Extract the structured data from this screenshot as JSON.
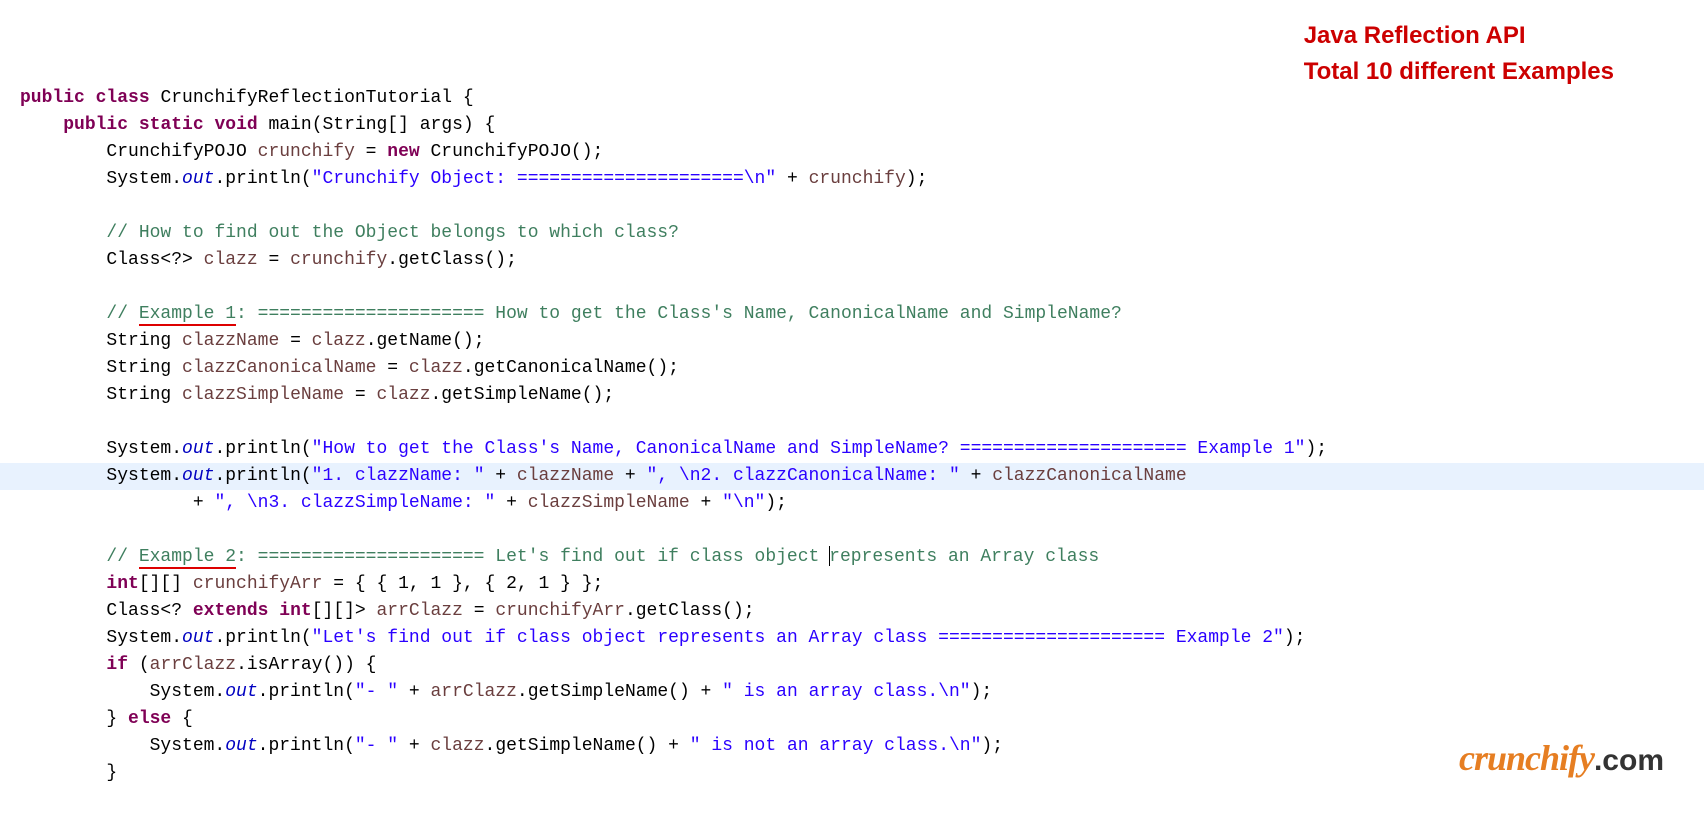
{
  "annotation": {
    "line1": "Java Reflection API",
    "line2": "Total 10 different Examples"
  },
  "logo": {
    "brand": "crunchify",
    "suffix": ".com"
  },
  "code": {
    "l1_public": "public",
    "l1_class": "class",
    "l1_name": " CrunchifyReflectionTutorial {",
    "l2_public": "public",
    "l2_static": "static",
    "l2_void": "void",
    "l2_sig": " main(String[] args) {",
    "l3_a": "CrunchifyPOJO ",
    "l3_var": "crunchify",
    "l3_b": " = ",
    "l3_new": "new",
    "l3_c": " CrunchifyPOJO();",
    "l4_a": "System.",
    "l4_out": "out",
    "l4_b": ".println(",
    "l4_str": "\"Crunchify Object: =====================\\n\"",
    "l4_c": " + ",
    "l4_var": "crunchify",
    "l4_d": ");",
    "l6_cmt": "// How to find out the Object belongs to which class?",
    "l7_a": "Class<?> ",
    "l7_var": "clazz",
    "l7_b": " = ",
    "l7_var2": "crunchify",
    "l7_c": ".getClass();",
    "l9_cmt_a": "// ",
    "l9_ex": "Example 1",
    "l9_cmt_b": ": ===================== How to get the Class's Name, CanonicalName and SimpleName?",
    "l10_a": "String ",
    "l10_var": "clazzName",
    "l10_b": " = ",
    "l10_var2": "clazz",
    "l10_c": ".getName();",
    "l11_a": "String ",
    "l11_var": "clazzCanonicalName",
    "l11_b": " = ",
    "l11_var2": "clazz",
    "l11_c": ".getCanonicalName();",
    "l12_a": "String ",
    "l12_var": "clazzSimpleName",
    "l12_b": " = ",
    "l12_var2": "clazz",
    "l12_c": ".getSimpleName();",
    "l14_a": "System.",
    "l14_out": "out",
    "l14_b": ".println(",
    "l14_str": "\"How to get the Class's Name, CanonicalName and SimpleName? ===================== Example 1\"",
    "l14_c": ");",
    "l15_a": "System.",
    "l15_out": "out",
    "l15_b": ".println(",
    "l15_str1": "\"1. clazzName: \"",
    "l15_c": " + ",
    "l15_var1": "clazzName",
    "l15_d": " + ",
    "l15_str2": "\", \\n2. clazzCanonicalName: \"",
    "l15_e": " + ",
    "l15_var2": "clazzCanonicalName",
    "l16_a": "+ ",
    "l16_str1": "\", \\n3. clazzSimpleName: \"",
    "l16_b": " + ",
    "l16_var": "clazzSimpleName",
    "l16_c": " + ",
    "l16_str2": "\"\\n\"",
    "l16_d": ");",
    "l18_cmt_a": "// ",
    "l18_ex": "Example 2",
    "l18_cmt_b": ": ===================== Let's find out if class object ",
    "l18_cmt_c": "represents an Array class",
    "l19_int": "int",
    "l19_a": "[][] ",
    "l19_var": "crunchifyArr",
    "l19_b": " = { { 1, 1 }, { 2, 1 } };",
    "l20_a": "Class<? ",
    "l20_ext": "extends",
    "l20_b": " ",
    "l20_int": "int",
    "l20_c": "[][]> ",
    "l20_var": "arrClazz",
    "l20_d": " = ",
    "l20_var2": "crunchifyArr",
    "l20_e": ".getClass();",
    "l21_a": "System.",
    "l21_out": "out",
    "l21_b": ".println(",
    "l21_str": "\"Let's find out if class object represents an Array class ===================== Example 2\"",
    "l21_c": ");",
    "l22_if": "if",
    "l22_a": " (",
    "l22_var": "arrClazz",
    "l22_b": ".isArray()) {",
    "l23_a": "System.",
    "l23_out": "out",
    "l23_b": ".println(",
    "l23_str1": "\"- \"",
    "l23_c": " + ",
    "l23_var": "arrClazz",
    "l23_d": ".getSimpleName() + ",
    "l23_str2": "\" is an array class.\\n\"",
    "l23_e": ");",
    "l24_a": "} ",
    "l24_else": "else",
    "l24_b": " {",
    "l25_a": "System.",
    "l25_out": "out",
    "l25_b": ".println(",
    "l25_str1": "\"- \"",
    "l25_c": " + ",
    "l25_var": "clazz",
    "l25_d": ".getSimpleName() + ",
    "l25_str2": "\" is not an array class.\\n\"",
    "l25_e": ");",
    "l26_a": "}"
  }
}
